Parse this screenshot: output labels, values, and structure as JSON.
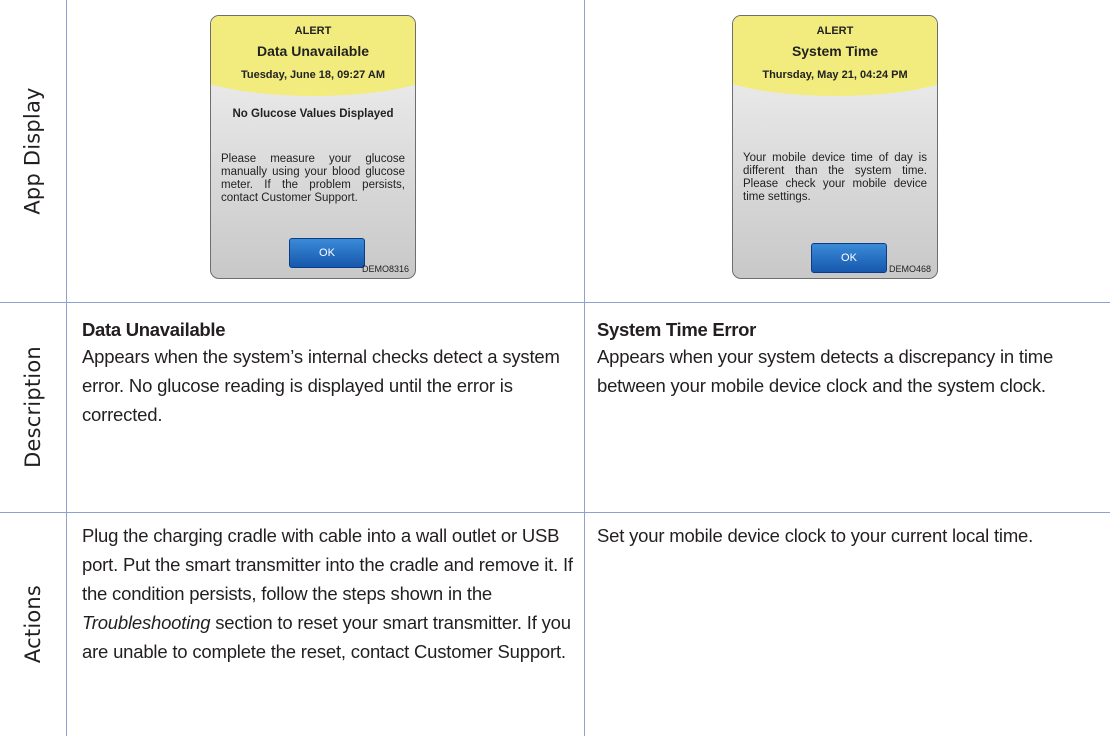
{
  "row_labels": {
    "app_display": "App Display",
    "description": "Description",
    "actions": "Actions"
  },
  "alerts": [
    {
      "header": "ALERT",
      "title": "Data Unavailable",
      "datetime": "Tuesday, June 18, 09:27 AM",
      "subtitle": "No Glucose Values Displayed",
      "message": "Please measure your glucose manually using your blood glucose meter. If the problem persists, contact Customer Support.",
      "button": "OK",
      "code": "DEMO8316"
    },
    {
      "header": "ALERT",
      "title": "System Time",
      "datetime": "Thursday, May 21, 04:24 PM",
      "message": "Your mobile device time of day is different than the system time. Please check your mobile device time settings.",
      "button": "OK",
      "code": "DEMO468"
    }
  ],
  "descriptions": [
    {
      "title": "Data Unavailable",
      "text": "Appears when the system’s internal checks detect a system error. No glucose reading is displayed until the error is corrected."
    },
    {
      "title": "System Time Error",
      "text": "Appears when your system detects a discrepancy in time between your mobile device clock and the system clock."
    }
  ],
  "actions": [
    {
      "text_before": "Plug the charging cradle with cable into a wall outlet or USB port. Put the smart transmitter into the cradle and remove it. If the condition persists, follow the steps shown in the ",
      "text_italic": "Troubleshooting",
      "text_after": " section to reset your smart transmitter. If you are unable to complete the reset, contact Customer Support."
    },
    {
      "text": "Set your mobile device clock to your current local time."
    }
  ]
}
